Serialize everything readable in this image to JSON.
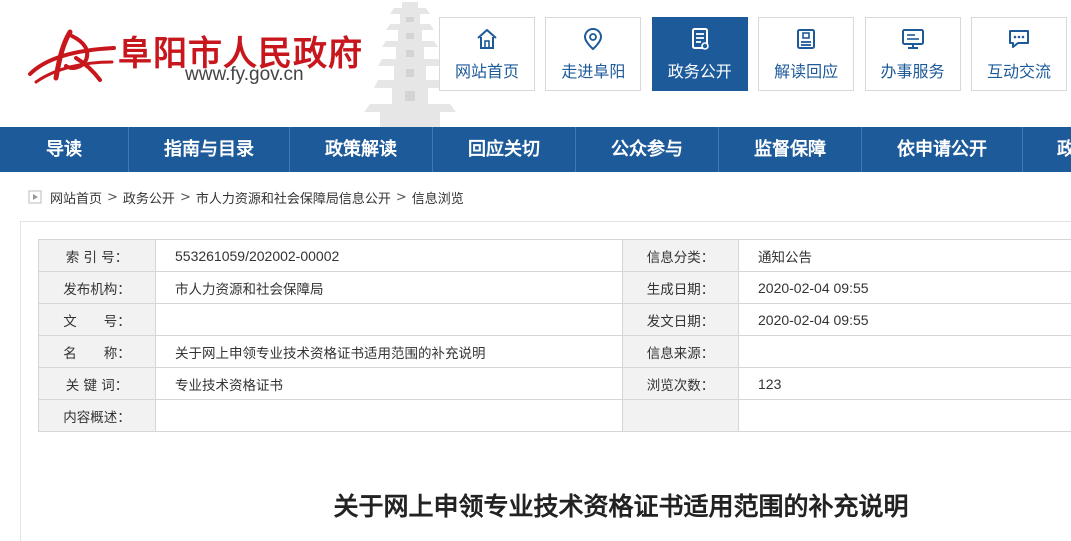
{
  "site": {
    "title": "阜阳市人民政府",
    "url": "www.fy.gov.cn",
    "brand_color": "#c8161d",
    "accent_color": "#1d5a9a"
  },
  "top_nav": [
    {
      "label": "网站首页",
      "icon": "home-icon",
      "active": false
    },
    {
      "label": "走进阜阳",
      "icon": "location-pin-icon",
      "active": false
    },
    {
      "label": "政务公开",
      "icon": "document-list-icon",
      "active": true
    },
    {
      "label": "解读回应",
      "icon": "notepad-icon",
      "active": false
    },
    {
      "label": "办事服务",
      "icon": "monitor-icon",
      "active": false
    },
    {
      "label": "互动交流",
      "icon": "chat-bubble-icon",
      "active": false
    }
  ],
  "main_nav": [
    "导读",
    "指南与目录",
    "政策解读",
    "回应关切",
    "公众参与",
    "监督保障",
    "依申请公开",
    "政"
  ],
  "breadcrumb": {
    "icon": "breadcrumb-icon",
    "items": [
      "网站首页",
      "政务公开",
      "市人力资源和社会保障局信息公开",
      "信息浏览"
    ],
    "separator": ">"
  },
  "meta": {
    "index_label": "索 引 号：",
    "index_value": "553261059/202002-00002",
    "category_label": "信息分类：",
    "category_value": "通知公告",
    "publisher_label": "发布机构：",
    "publisher_value": "市人力资源和社会保障局",
    "created_label": "生成日期：",
    "created_value": "2020-02-04 09:55",
    "doc_no_label": "文　　号：",
    "doc_no_value": "",
    "issued_label": "发文日期：",
    "issued_value": "2020-02-04 09:55",
    "name_label": "名　　称：",
    "name_value": "关于网上申领专业技术资格证书适用范围的补充说明",
    "source_label": "信息来源：",
    "source_value": "",
    "keywords_label": "关 键 词：",
    "keywords_value": "专业技术资格证书",
    "views_label": "浏览次数：",
    "views_value": "123",
    "summary_label": "内容概述：",
    "summary_value": ""
  },
  "document": {
    "title": "关于网上申领专业技术资格证书适用范围的补充说明"
  }
}
